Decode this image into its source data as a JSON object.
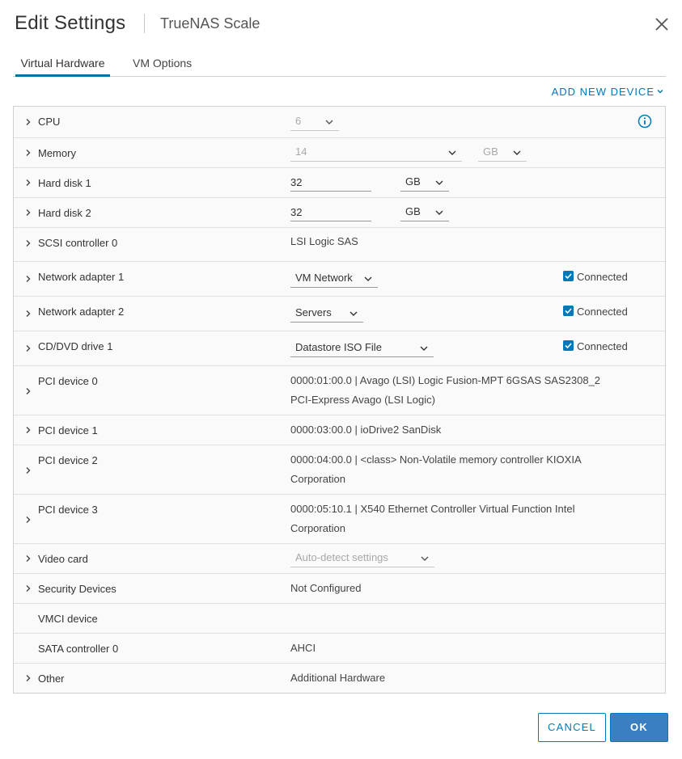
{
  "dialog": {
    "title": "Edit Settings",
    "subtitle": "TrueNAS Scale"
  },
  "tabs": [
    {
      "label": "Virtual Hardware",
      "active": true
    },
    {
      "label": "VM Options",
      "active": false
    }
  ],
  "add_device_label": "ADD NEW DEVICE",
  "rows": {
    "cpu": {
      "label": "CPU",
      "value": "6"
    },
    "memory": {
      "label": "Memory",
      "value": "14",
      "unit": "GB"
    },
    "hd1": {
      "label": "Hard disk 1",
      "value": "32",
      "unit": "GB"
    },
    "hd2": {
      "label": "Hard disk 2",
      "value": "32",
      "unit": "GB"
    },
    "scsi": {
      "label": "SCSI controller 0",
      "value": "LSI Logic SAS"
    },
    "net1": {
      "label": "Network adapter 1",
      "value": "VM Network",
      "status": "Connected"
    },
    "net2": {
      "label": "Network adapter 2",
      "value": "Servers",
      "status": "Connected"
    },
    "cd": {
      "label": "CD/DVD drive 1",
      "value": "Datastore ISO File",
      "status": "Connected"
    },
    "pci0": {
      "label": "PCI device 0",
      "line1": "0000:01:00.0 | Avago (LSI) Logic Fusion-MPT 6GSAS SAS2308_2",
      "line2": "PCI-Express Avago (LSI Logic)"
    },
    "pci1": {
      "label": "PCI device 1",
      "value": "0000:03:00.0 | ioDrive2 SanDisk"
    },
    "pci2": {
      "label": "PCI device 2",
      "line1": "0000:04:00.0 | <class> Non-Volatile memory controller KIOXIA",
      "line2": "Corporation"
    },
    "pci3": {
      "label": "PCI device 3",
      "line1": "0000:05:10.1 | X540 Ethernet Controller Virtual Function Intel",
      "line2": "Corporation"
    },
    "video": {
      "label": "Video card",
      "value": "Auto-detect settings"
    },
    "security": {
      "label": "Security Devices",
      "value": "Not Configured"
    },
    "vmci": {
      "label": "VMCI device"
    },
    "sata": {
      "label": "SATA controller 0",
      "value": "AHCI"
    },
    "other": {
      "label": "Other",
      "value": "Additional Hardware"
    }
  },
  "buttons": {
    "cancel": "CANCEL",
    "ok": "OK"
  },
  "colors": {
    "accent": "#0079b8",
    "primary_button": "#3a7fc1",
    "tab_underline": "#0072a3"
  }
}
